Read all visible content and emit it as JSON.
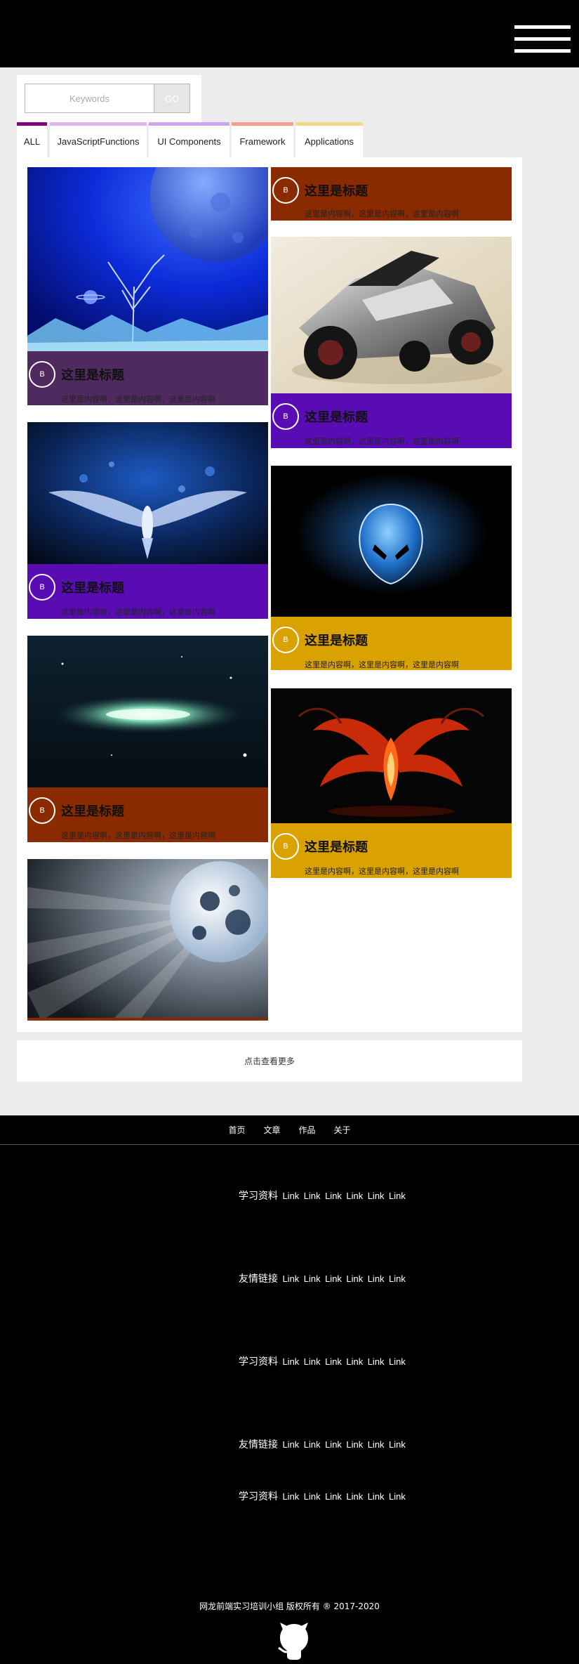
{
  "header": {
    "menu_icon": "hamburger-menu-icon"
  },
  "search": {
    "placeholder": "Keywords",
    "button_label": "GO"
  },
  "tabs": [
    {
      "label": "ALL",
      "color": "#800080"
    },
    {
      "label": "JavaScriptFunctions",
      "color": "#dcb8e8"
    },
    {
      "label": "UI Components",
      "color": "#c9a8f0"
    },
    {
      "label": "Framework",
      "color": "#f4a08a"
    },
    {
      "label": "Applications",
      "color": "#f5d68a"
    }
  ],
  "cards": [
    {
      "image": "moon-tree-landscape",
      "badge": "B",
      "title": "这里是标题",
      "desc": "这里是内容啊，这里是内容啊，这里是内容啊",
      "color": "#4f2a5e"
    },
    {
      "image": "winged-emblem",
      "badge": "B",
      "title": "这里是标题",
      "desc": "这里是内容啊，这里是内容啊，这里是内容啊",
      "color": "#5a0cb4"
    },
    {
      "image": "galaxy",
      "badge": "B",
      "title": "这里是标题",
      "desc": "这里是内容啊，这里是内容啊，这里是内容啊",
      "color": "#8a2a00"
    },
    {
      "image": "burst-planet",
      "badge": "",
      "title": "",
      "desc": "",
      "color": "#8a2a00"
    },
    {
      "image": "",
      "badge": "B",
      "title": "这里是标题",
      "desc": "这里是内容啊，这里是内容啊，这里是内容啊",
      "color": "#8a2a00"
    },
    {
      "image": "futuristic-vehicle",
      "badge": "B",
      "title": "这里是标题",
      "desc": "这里是内容啊，这里是内容啊，这里是内容啊",
      "color": "#5a0cb4"
    },
    {
      "image": "alien-head-logo",
      "badge": "B",
      "title": "这里是标题",
      "desc": "这里是内容啊，这里是内容啊，这里是内容啊",
      "color": "#d9a200"
    },
    {
      "image": "red-dragon-art",
      "badge": "B",
      "title": "这里是标题",
      "desc": "这里是内容啊，这里是内容啊，这里是内容啊",
      "color": "#d9a200"
    }
  ],
  "load_more": "点击查看更多",
  "footer": {
    "nav": [
      "首页",
      "文章",
      "作品",
      "关于"
    ],
    "rows": [
      {
        "label": "学习资料",
        "links": [
          "Link",
          "Link",
          "Link",
          "Link",
          "Link",
          "Link"
        ]
      },
      {
        "label": "友情链接",
        "links": [
          "Link",
          "Link",
          "Link",
          "Link",
          "Link",
          "Link"
        ]
      },
      {
        "label": "学习资料",
        "links": [
          "Link",
          "Link",
          "Link",
          "Link",
          "Link",
          "Link"
        ]
      },
      {
        "label": "友情链接",
        "links": [
          "Link",
          "Link",
          "Link",
          "Link",
          "Link",
          "Link"
        ]
      },
      {
        "label": "学习资料",
        "links": [
          "Link",
          "Link",
          "Link",
          "Link",
          "Link",
          "Link"
        ]
      }
    ],
    "copyright": "网龙前端实习培训小组 版权所有 ® 2017-2020",
    "github_icon": "github-octocat-icon"
  }
}
